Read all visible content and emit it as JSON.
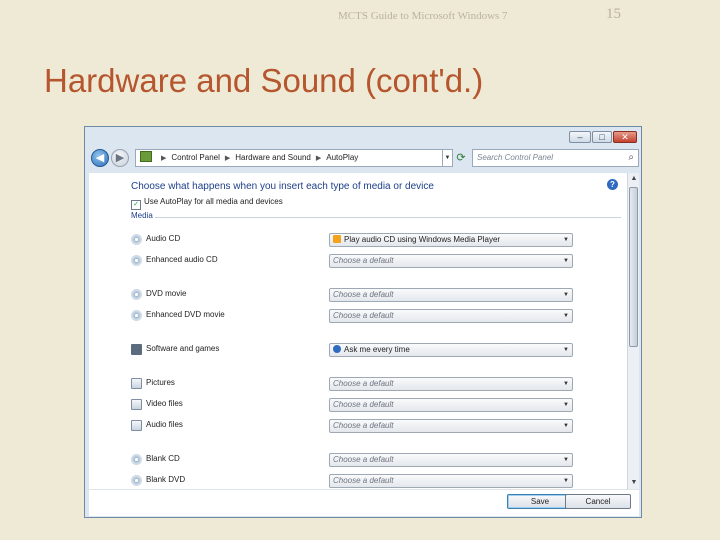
{
  "slide": {
    "subtitle": "MCTS Guide to Microsoft Windows 7",
    "page_number": "15",
    "title": "Hardware and Sound (cont'd.)"
  },
  "window": {
    "controls": {
      "minimize": "–",
      "maximize": "□",
      "close": "✕"
    },
    "address": {
      "crumbs": [
        "Control Panel",
        "Hardware and Sound",
        "AutoPlay"
      ],
      "search_placeholder": "Search Control Panel"
    },
    "heading": "Choose what happens when you insert each type of media or device",
    "help": "?",
    "autoplay_label": "Use AutoPlay for all media and devices",
    "autoplay_checked": true,
    "section": "Media",
    "rows": [
      {
        "label": "Audio CD",
        "value": "Play audio CD using Windows Media Player",
        "placeholder": false,
        "icon": "disc-icon",
        "sel_icon": "play"
      },
      {
        "label": "Enhanced audio CD",
        "value": "Choose a default",
        "placeholder": true,
        "icon": "disc-icon"
      },
      {
        "label": "DVD movie",
        "value": "Choose a default",
        "placeholder": true,
        "icon": "disc-icon"
      },
      {
        "label": "Enhanced DVD movie",
        "value": "Choose a default",
        "placeholder": true,
        "icon": "disc-icon"
      },
      {
        "label": "Software and games",
        "value": "Ask me every time",
        "placeholder": false,
        "icon": "software-icon",
        "sel_icon": "ask"
      },
      {
        "label": "Pictures",
        "value": "Choose a default",
        "placeholder": true,
        "icon": "pictures-icon"
      },
      {
        "label": "Video files",
        "value": "Choose a default",
        "placeholder": true,
        "icon": "video-icon"
      },
      {
        "label": "Audio files",
        "value": "Choose a default",
        "placeholder": true,
        "icon": "audio-icon"
      },
      {
        "label": "Blank CD",
        "value": "Choose a default",
        "placeholder": true,
        "icon": "disc-icon"
      },
      {
        "label": "Blank DVD",
        "value": "Choose a default",
        "placeholder": true,
        "icon": "disc-icon"
      }
    ],
    "buttons": {
      "save": "Save",
      "cancel": "Cancel"
    }
  },
  "colors": {
    "title": "#b5562e",
    "background": "#efead6",
    "link_heading": "#1e3f8a"
  }
}
